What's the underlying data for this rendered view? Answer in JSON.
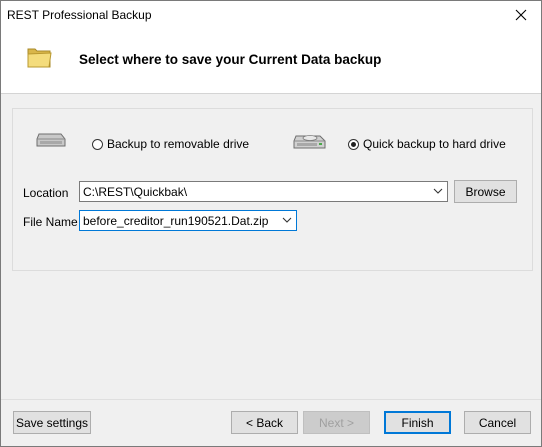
{
  "window": {
    "title": "REST Professional Backup"
  },
  "header": {
    "title": "Select where to save your Current Data backup"
  },
  "options": {
    "removable": {
      "label": "Backup to removable drive",
      "selected": false
    },
    "harddrive": {
      "label": "Quick backup to hard drive",
      "selected": true
    }
  },
  "location": {
    "label": "Location",
    "value": "C:\\REST\\Quickbak\\"
  },
  "filename": {
    "label": "File Name",
    "value": "before_creditor_run190521.Dat.zip"
  },
  "buttons": {
    "browse": "Browse",
    "save_settings": "Save settings",
    "back": "< Back",
    "next": "Next >",
    "finish": "Finish",
    "cancel": "Cancel"
  }
}
